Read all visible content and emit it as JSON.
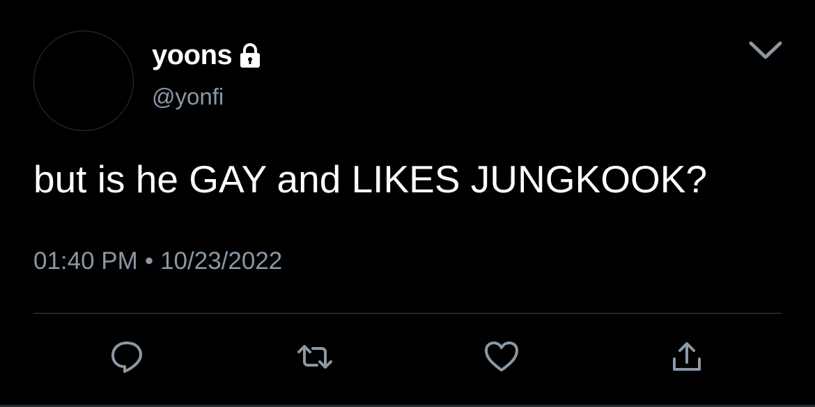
{
  "tweet": {
    "display_name": "yoons",
    "handle": "@yonfi",
    "text": "but is he GAY and LIKES JUNGKOOK?",
    "time": "01:40 PM",
    "separator": "•",
    "date": "10/23/2022",
    "protected_icon": "lock-icon"
  },
  "actions": [
    {
      "name": "reply",
      "icon": "speech-bubble-icon"
    },
    {
      "name": "retweet",
      "icon": "retweet-arrows-icon"
    },
    {
      "name": "like",
      "icon": "heart-icon"
    },
    {
      "name": "share",
      "icon": "upload-arrow-icon"
    }
  ],
  "colors": {
    "background": "#000000",
    "text_primary": "#ffffff",
    "text_secondary": "#8b98a5",
    "divider": "#38444d",
    "icon": "#8b98a5"
  }
}
